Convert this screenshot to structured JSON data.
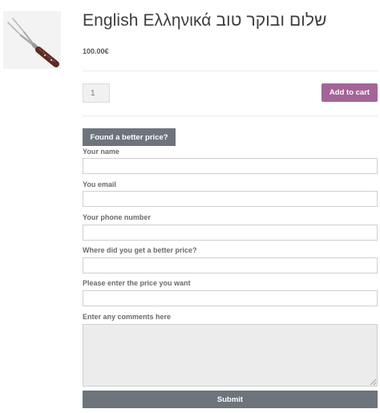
{
  "product": {
    "title": "English Ελληνικά שלום ובוקר טוב",
    "price": "100.00€",
    "quantity_value": "1",
    "image_icon": "carving-fork-icon"
  },
  "actions": {
    "add_to_cart_label": "Add to cart",
    "better_price_label": "Found a better price?",
    "submit_label": "Submit"
  },
  "form": {
    "name_label": "Your name",
    "email_label": "You email",
    "phone_label": "Your phone number",
    "where_label": "Where did you get a better price?",
    "price_label": "Please enter the price you want",
    "comments_label": "Enter any comments here",
    "name_value": "",
    "email_value": "",
    "phone_value": "",
    "where_value": "",
    "price_value": "",
    "comments_value": ""
  },
  "colors": {
    "cart_button": "#a46497",
    "form_button": "#6d747c"
  }
}
